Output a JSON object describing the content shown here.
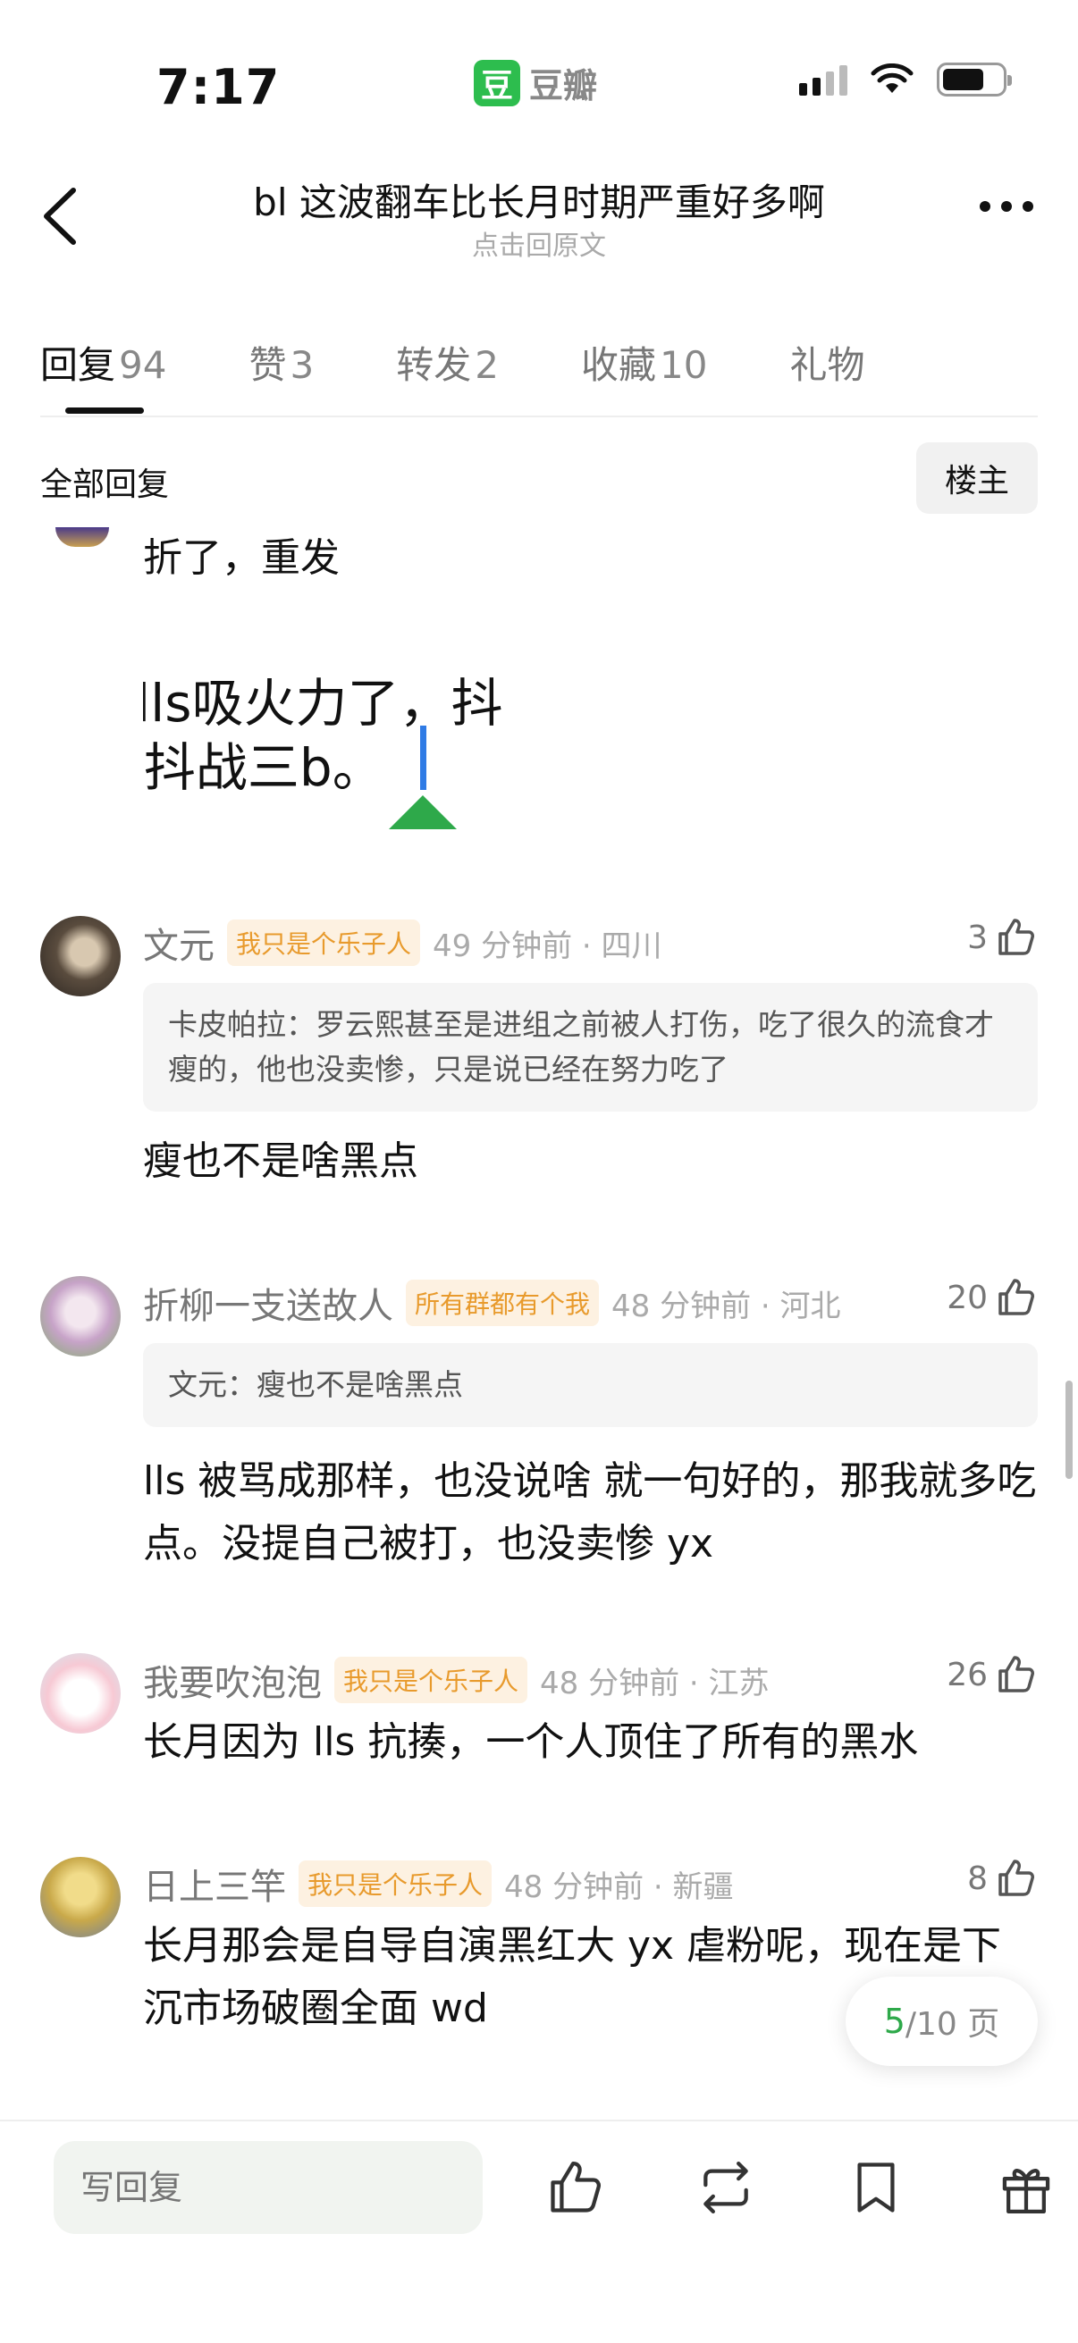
{
  "status_bar": {
    "time": "7:17",
    "app_badge": "豆",
    "app_name": "豆瓣"
  },
  "nav": {
    "title": "bl 这波翻车比长月时期严重好多啊",
    "subtitle": "点击回原文"
  },
  "tabs": [
    {
      "label": "回复",
      "count": "94"
    },
    {
      "label": "赞",
      "count": "3"
    },
    {
      "label": "转发",
      "count": "2"
    },
    {
      "label": "收藏",
      "count": "10"
    },
    {
      "label": "礼物",
      "count": ""
    }
  ],
  "filter": {
    "label": "全部回复",
    "owner_button": "楼主"
  },
  "first_comment": {
    "text": "折了，重发",
    "image_line1": "lls吸火力了，抖",
    "image_line2": "-抖战三b。"
  },
  "comments": [
    {
      "name": "文元",
      "badge": "我只是个乐子人",
      "time_loc": "49 分钟前 · 四川",
      "likes": "3",
      "quote": "卡皮帕拉：罗云熙甚至是进组之前被人打伤，吃了很久的流食才瘦的，他也没卖惨，只是说已经在努力吃了",
      "text": "瘦也不是啥黑点"
    },
    {
      "name": "折柳一支送故人",
      "badge": "所有群都有个我",
      "time_loc": "48 分钟前 · 河北",
      "likes": "20",
      "quote": "文元：瘦也不是啥黑点",
      "text": "lls 被骂成那样，也没说啥 就一句好的，那我就多吃点。没提自己被打，也没卖惨 yx"
    },
    {
      "name": "我要吹泡泡",
      "badge": "我只是个乐子人",
      "time_loc": "48 分钟前 · 江苏",
      "likes": "26",
      "quote": "",
      "text": "长月因为 lls 抗揍，一个人顶住了所有的黑水"
    },
    {
      "name": "日上三竿",
      "badge": "我只是个乐子人",
      "time_loc": "48 分钟前 · 新疆",
      "likes": "8",
      "quote": "",
      "text": "长月那会是自导自演黑红大 yx 虐粉呢，现在是下沉市场破圈全面 wd"
    }
  ],
  "pagination": {
    "current": "5",
    "total": "/10 页"
  },
  "bottom_bar": {
    "reply_placeholder": "写回复"
  },
  "colors": {
    "accent_green": "#2ea94a",
    "badge_orange": "#e89a2c"
  }
}
